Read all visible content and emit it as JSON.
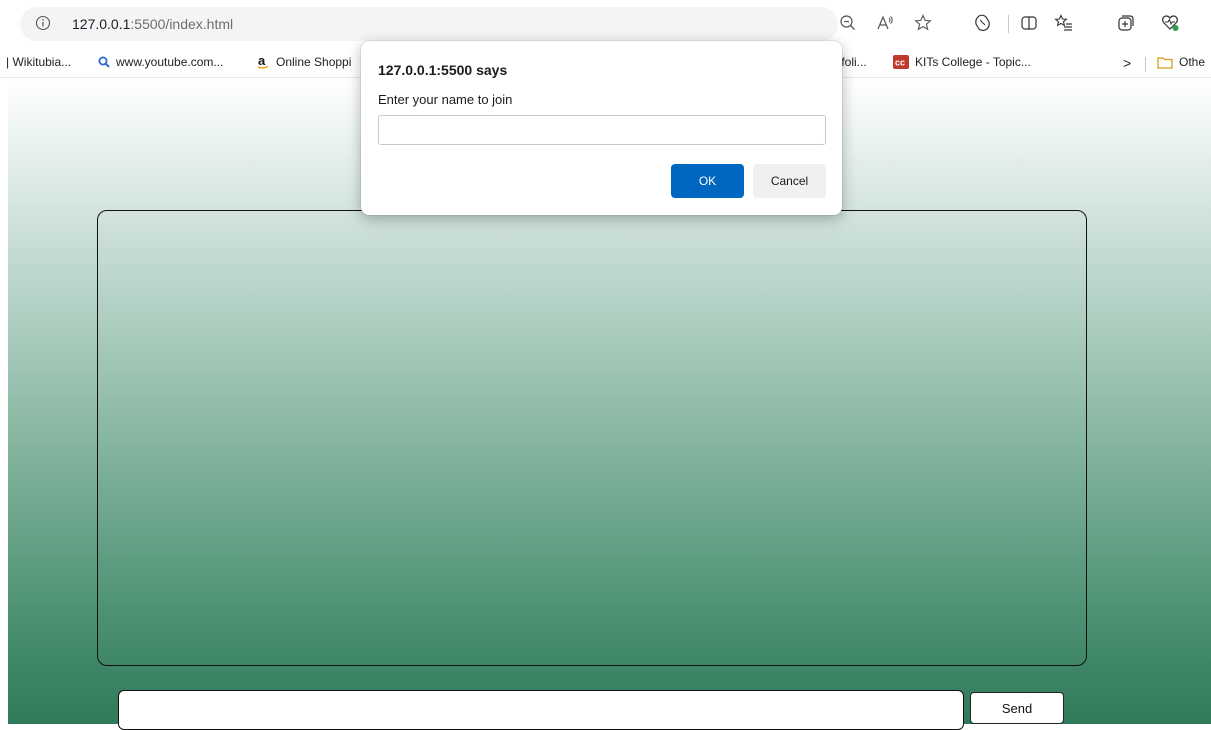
{
  "browser": {
    "url_host": "127.0.0.1",
    "url_rest": ":5500/index.html",
    "toolbar_icons": [
      "zoom-out-icon",
      "read-aloud-icon",
      "favorite-star-icon",
      "copilot-icon",
      "split-screen-icon",
      "favorites-list-icon",
      "collections-icon",
      "browser-essentials-icon"
    ]
  },
  "bookmarks": {
    "items": [
      {
        "label": "| Wikitubia...",
        "icon": "none"
      },
      {
        "label": "www.youtube.com...",
        "icon": "search-icon"
      },
      {
        "label": "Online Shoppi",
        "icon": "amazon-icon"
      },
      {
        "label": "tfoli...",
        "icon": "none"
      },
      {
        "label": "KITs College - Topic...",
        "icon": "cc-icon"
      }
    ],
    "overflow_label": ">",
    "other_label": "Othe"
  },
  "dialog": {
    "title": "127.0.0.1:5500 says",
    "message": "Enter your name to join",
    "input_value": "",
    "ok_label": "OK",
    "cancel_label": "Cancel"
  },
  "chat": {
    "message_input_value": "",
    "send_label": "Send"
  },
  "colors": {
    "accent": "#0067c0",
    "gradient_top": "#ffffff",
    "gradient_bottom": "#2f7a5a"
  }
}
